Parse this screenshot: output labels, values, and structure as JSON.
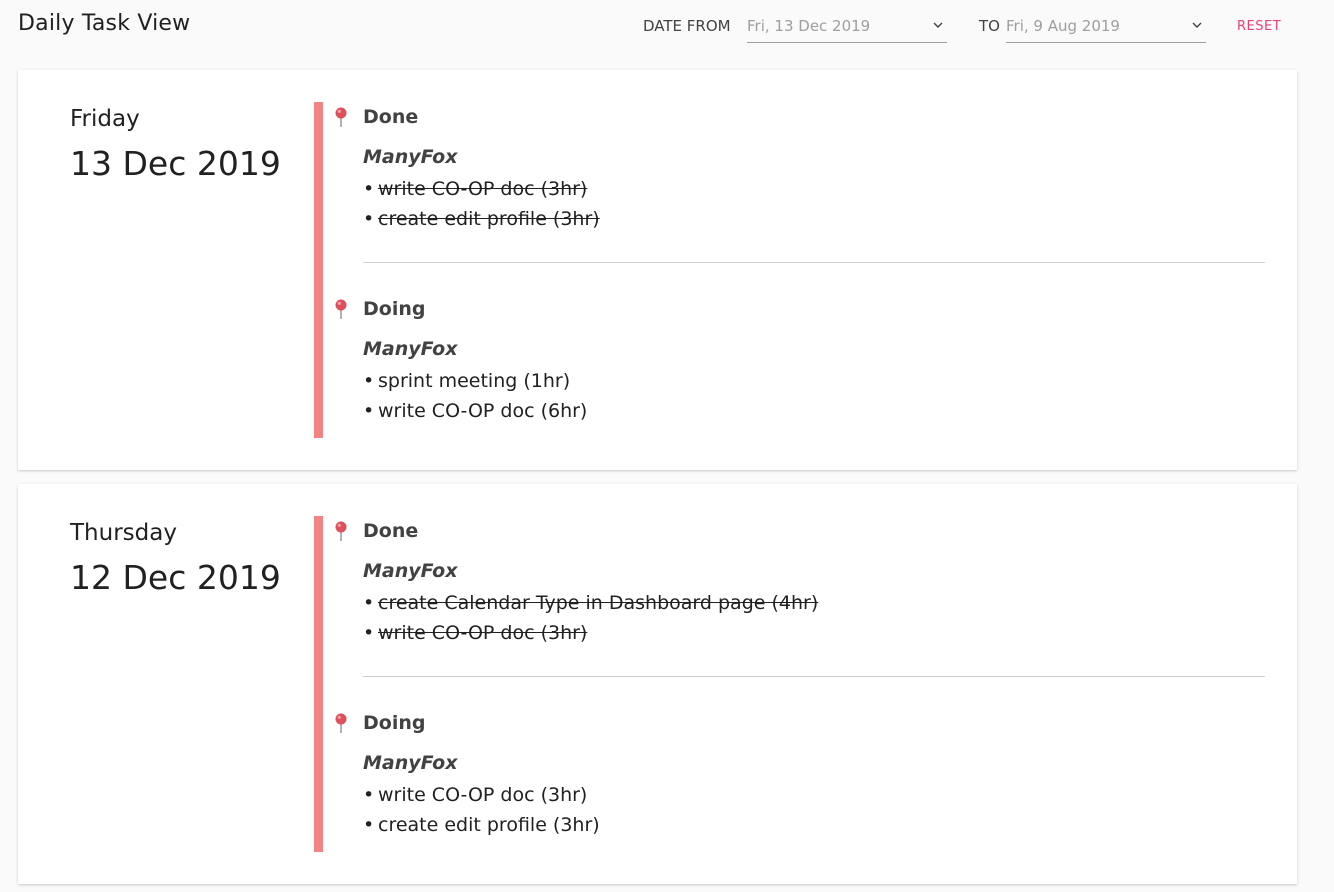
{
  "header": {
    "title": "Daily Task View",
    "date_from_label": "DATE FROM",
    "date_from_value": "Fri, 13 Dec 2019",
    "to_label": "TO",
    "to_value": "Fri, 9 Aug 2019",
    "reset_label": "RESET"
  },
  "colors": {
    "accent_bar": "#f48484",
    "reset": "#ec407a",
    "pin": "#e0505a"
  },
  "icons": {
    "dropdown": "chevron-down-icon",
    "status": "pin-icon"
  },
  "days": [
    {
      "weekday": "Friday",
      "date": "13 Dec 2019",
      "sections": [
        {
          "status": "Done",
          "project": "ManyFox",
          "tasks": [
            {
              "text": "write CO-OP doc (3hr)",
              "completed": true
            },
            {
              "text": "create edit profile (3hr)",
              "completed": true
            }
          ]
        },
        {
          "status": "Doing",
          "project": "ManyFox",
          "tasks": [
            {
              "text": "sprint meeting (1hr)",
              "completed": false
            },
            {
              "text": "write CO-OP doc (6hr)",
              "completed": false
            }
          ]
        }
      ]
    },
    {
      "weekday": "Thursday",
      "date": "12 Dec 2019",
      "sections": [
        {
          "status": "Done",
          "project": "ManyFox",
          "tasks": [
            {
              "text": "create Calendar Type in Dashboard page (4hr)",
              "completed": true
            },
            {
              "text": "write CO-OP doc (3hr)",
              "completed": true
            }
          ]
        },
        {
          "status": "Doing",
          "project": "ManyFox",
          "tasks": [
            {
              "text": "write CO-OP doc (3hr)",
              "completed": false
            },
            {
              "text": "create edit profile (3hr)",
              "completed": false
            }
          ]
        }
      ]
    }
  ]
}
